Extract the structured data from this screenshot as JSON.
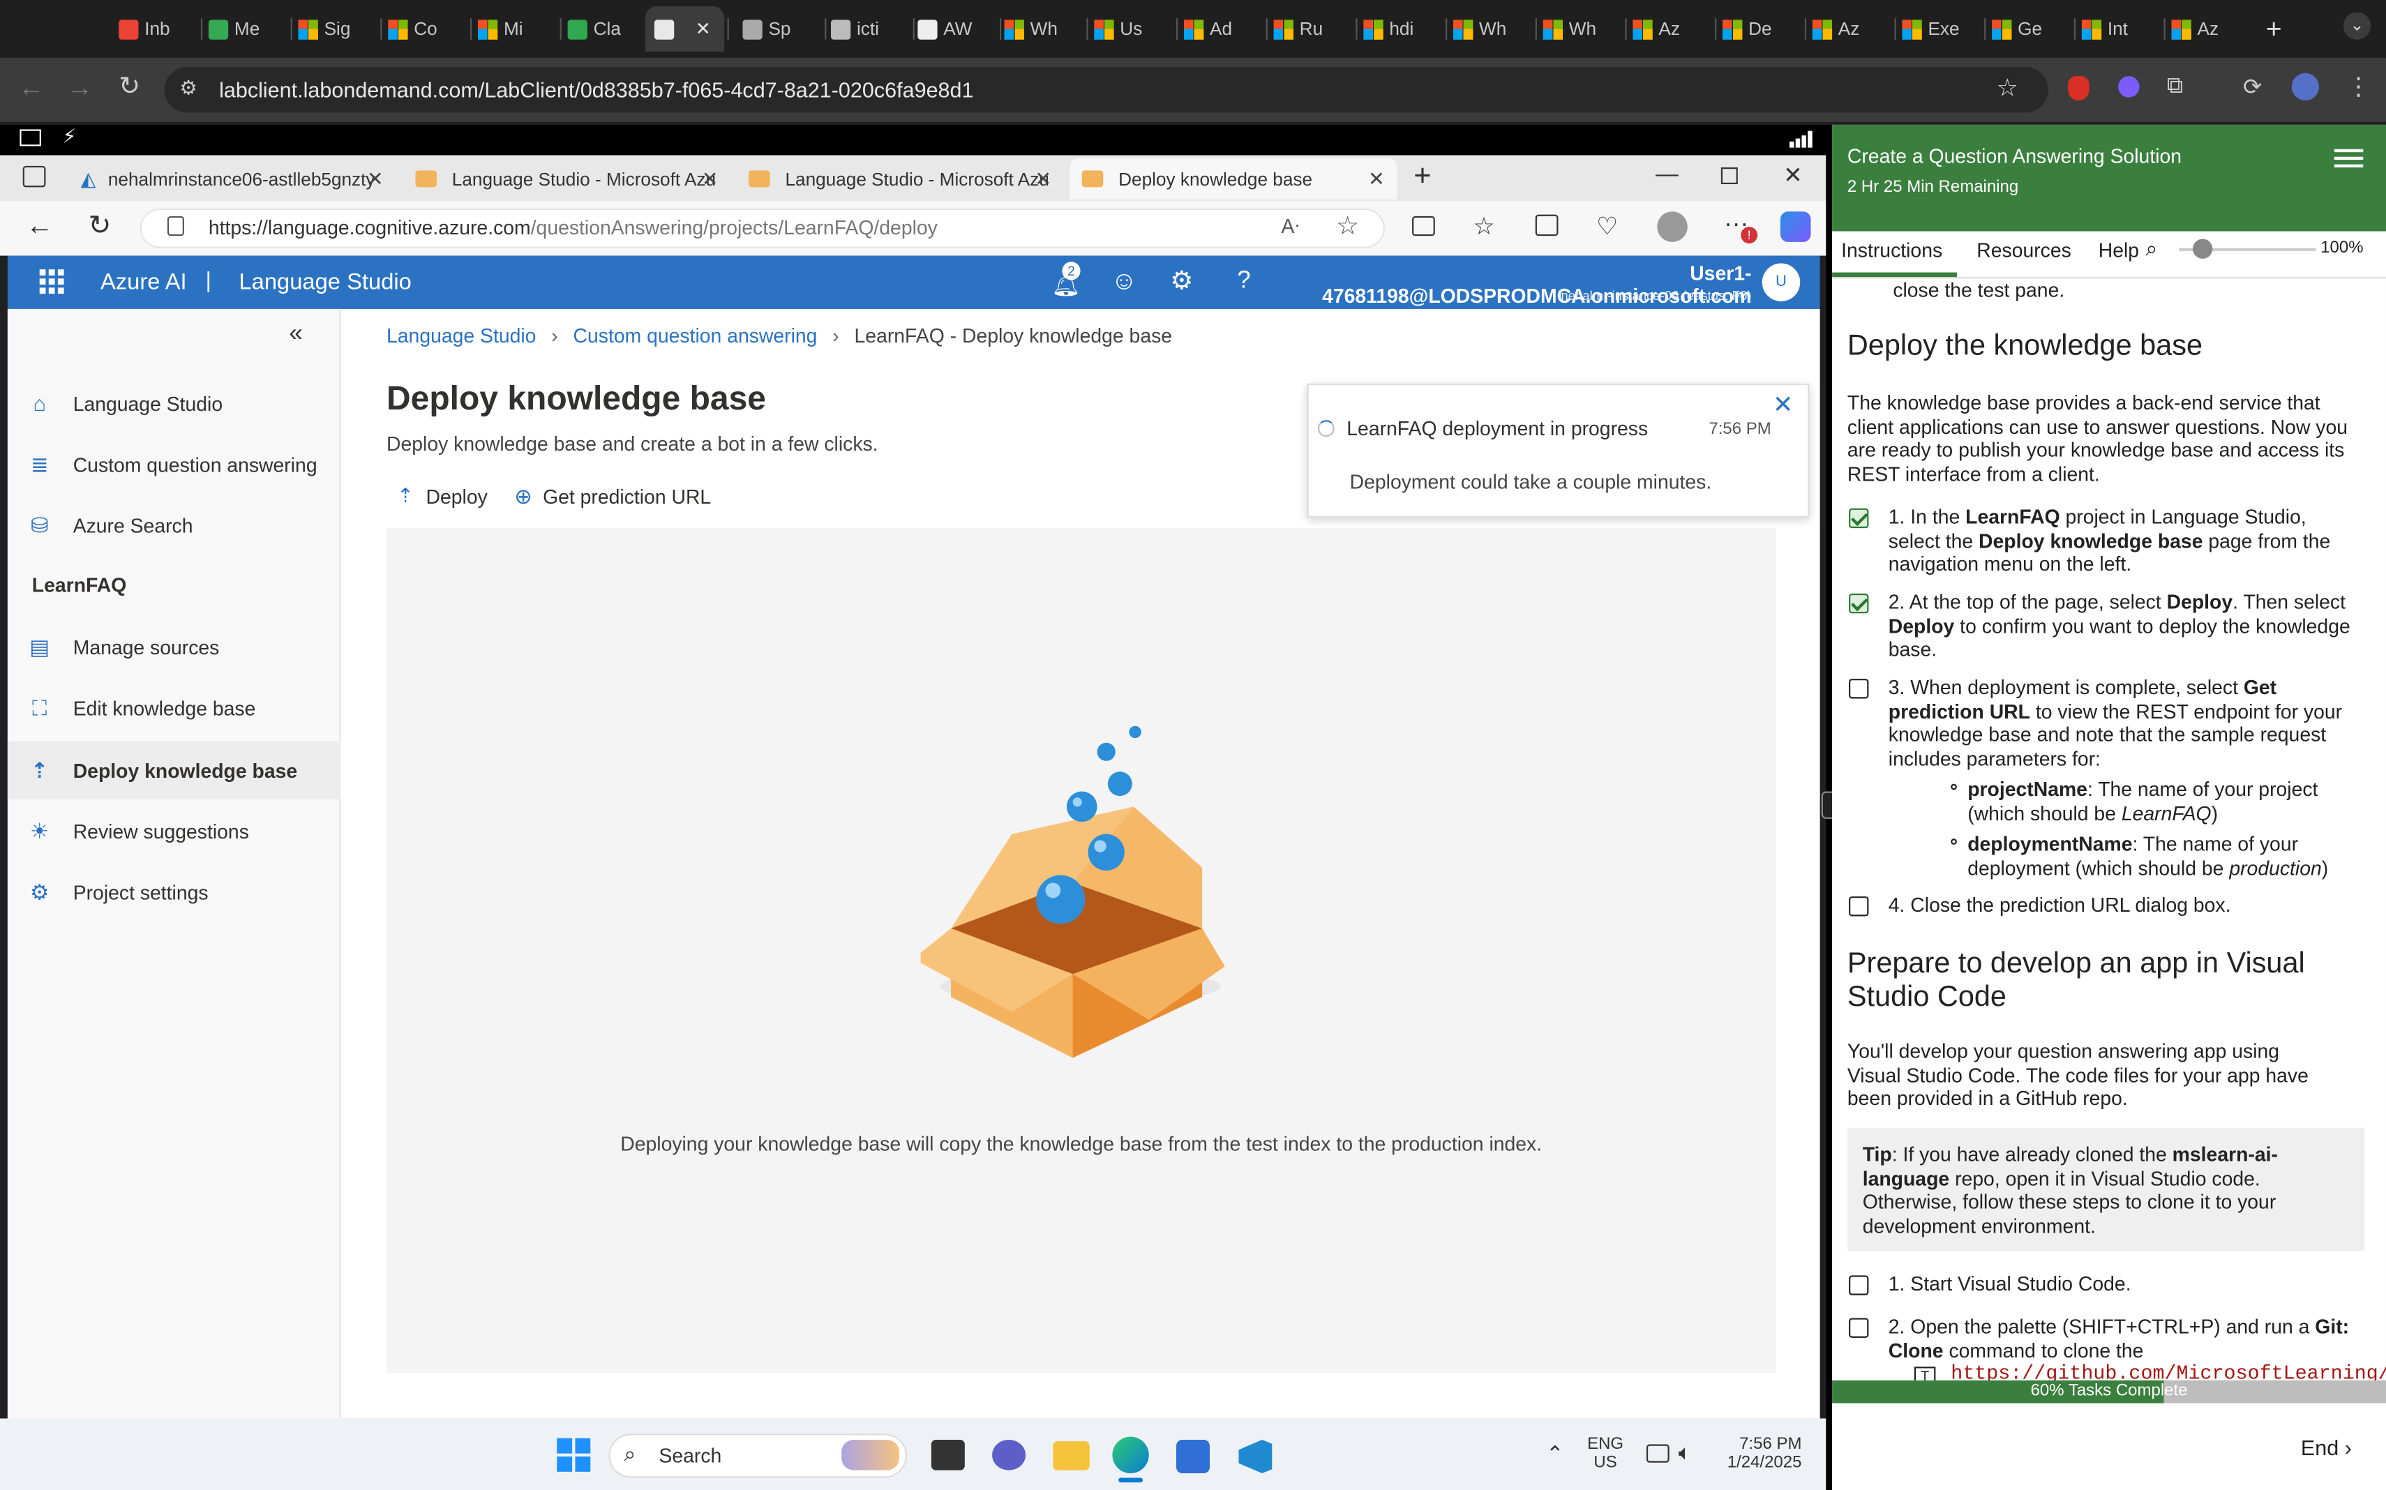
{
  "outer_browser": {
    "tabs": [
      "Inb",
      "Me",
      "Sig",
      "Co",
      "Mi",
      "Cla",
      "",
      "Sp",
      "icti",
      "AW",
      "Wh",
      "Us",
      "Ad",
      "Ru",
      "hdi",
      "Wh",
      "Wh",
      "Az",
      "De",
      "Az",
      "Exe",
      "Ge",
      "Int",
      "Az"
    ],
    "url": "labclient.labondemand.com/LabClient/0d8385b7-f065-4cd7-8a21-020c6fa9e8d1"
  },
  "edge": {
    "tabs": [
      {
        "label": "nehalmrinstance06-astlleb5gnzty"
      },
      {
        "label": "Language Studio - Microsoft Azu"
      },
      {
        "label": "Language Studio - Microsoft Azu"
      },
      {
        "label": "Deploy knowledge base"
      }
    ],
    "url_host": "https://language.cognitive.azure.com",
    "url_path": "/questionAnswering/projects/LearnFAQ/deploy",
    "notification_count": "2"
  },
  "app": {
    "brand": "Azure AI",
    "product": "Language Studio",
    "user_email": "User1-47681198@LODSPRODMCA.onmicrosoft.com",
    "user_resource": "nehalmr-instance-06 (eastus, F0)",
    "avatar": "U"
  },
  "nav": {
    "items": [
      {
        "label": "Language Studio",
        "icon": "home-icon"
      },
      {
        "label": "Custom question answering",
        "icon": "list-icon"
      },
      {
        "label": "Azure Search",
        "icon": "database-icon"
      }
    ],
    "project": "LearnFAQ",
    "project_items": [
      {
        "label": "Manage sources",
        "icon": "sources-icon"
      },
      {
        "label": "Edit knowledge base",
        "icon": "edit-kb-icon"
      },
      {
        "label": "Deploy knowledge base",
        "icon": "deploy-icon"
      },
      {
        "label": "Review suggestions",
        "icon": "lightbulb-icon"
      },
      {
        "label": "Project settings",
        "icon": "settings-icon"
      }
    ]
  },
  "main": {
    "breadcrumb": [
      "Language Studio",
      "Custom question answering",
      "LearnFAQ - Deploy knowledge base"
    ],
    "title": "Deploy knowledge base",
    "subtitle": "Deploy knowledge base and create a bot in a few clicks.",
    "deploy_label": "Deploy",
    "prediction_label": "Get prediction URL",
    "caption": "Deploying your knowledge base will copy the knowledge base from the test index to the production index."
  },
  "toast": {
    "title": "LearnFAQ deployment in progress",
    "time": "7:56 PM",
    "body": "Deployment could take a couple minutes."
  },
  "taskbar": {
    "search": "Search",
    "lang": "ENG",
    "region": "US",
    "time": "7:56 PM",
    "date": "1/24/2025"
  },
  "lab": {
    "title": "Create a Question Answering Solution",
    "remaining": "2 Hr 25 Min Remaining",
    "tabs": [
      "Instructions",
      "Resources",
      "Help"
    ],
    "zoom": "100%",
    "zoom_fraction": 0.1,
    "prev_text": "close the test pane.",
    "h_deploy": "Deploy the knowledge base",
    "p_deploy": "The knowledge base provides a back-end service that client applications can use to answer questions. Now you are ready to publish your knowledge base and access its REST interface from a client.",
    "step1_a": "1. In the ",
    "step1_b": "LearnFAQ",
    "step1_c": " project in Language Studio, select the ",
    "step1_d": "Deploy knowledge base",
    "step1_e": " page from the navigation menu on the left.",
    "step2_a": "2. At the top of the page, select ",
    "step2_b": "Deploy",
    "step2_c": ". Then select ",
    "step2_d": "Deploy",
    "step2_e": " to confirm you want to deploy the knowledge base.",
    "step3_a": "3. When deployment is complete, select ",
    "step3_b": "Get prediction URL",
    "step3_c": " to view the REST endpoint for your knowledge base and note that the sample request includes parameters for:",
    "bullet1_b": "projectName",
    "bullet1_a": ": The name of your project (which should be ",
    "bullet1_i": "LearnFAQ",
    "bullet1_c": ")",
    "bullet2_b": "deploymentName",
    "bullet2_a": ": The name of your deployment (which should be ",
    "bullet2_i": "production",
    "bullet2_c": ")",
    "step4": "4. Close the prediction URL dialog box.",
    "h_prepare": "Prepare to develop an app in Visual Studio Code",
    "p_prepare": "You'll develop your question answering app using Visual Studio Code. The code files for your app have been provided in a GitHub repo.",
    "tip_label": "Tip",
    "tip_a": ": If you have already cloned the ",
    "tip_b": "mslearn-ai-language",
    "tip_c": " repo, open it in Visual Studio code. Otherwise, follow these steps to clone it to your development environment.",
    "vs1": "1. Start Visual Studio Code.",
    "vs2_a": "2. Open the palette (SHIFT+CTRL+P) and run a ",
    "vs2_b": "Git: Clone",
    "vs2_c": " command to clone the",
    "code_snip": "https://github.com/MicrosoftLearning/",
    "checks": [
      true,
      true,
      false,
      false,
      false,
      false
    ],
    "progress_text": "60% Tasks Complete",
    "progress_fraction": 0.6,
    "end": "End"
  }
}
